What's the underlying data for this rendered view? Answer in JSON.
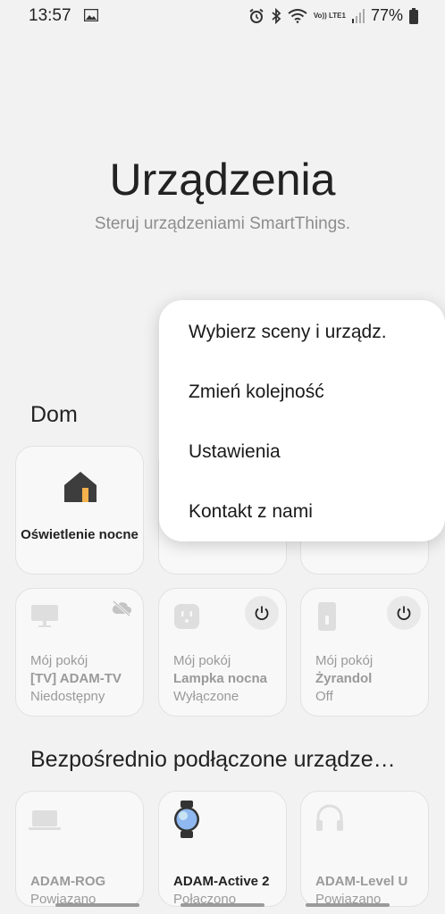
{
  "status_bar": {
    "time": "13:57",
    "battery": "77%",
    "volte": "Vo)) LTE1"
  },
  "header": {
    "title": "Urządzenia",
    "subtitle": "Steruj urządzeniami SmartThings."
  },
  "sections": {
    "home": "Dom",
    "direct": "Bezpośrednio podłączone urządze…"
  },
  "home_cards": {
    "night_light": {
      "label": "Oświetlenie nocne"
    },
    "tv": {
      "room": "Mój pokój",
      "name": "[TV] ADAM-TV",
      "status": "Niedostępny"
    },
    "lamp": {
      "room": "Mój pokój",
      "name": "Lampka nocna",
      "status": "Wyłączone"
    },
    "chandelier": {
      "room": "Mój pokój",
      "name": "Żyrandol",
      "status": "Off"
    }
  },
  "direct_cards": {
    "rog": {
      "name": "ADAM-ROG",
      "status": "Powiązano"
    },
    "watch": {
      "name": "ADAM-Active 2",
      "status": "Połączono"
    },
    "headphones": {
      "name": "ADAM-Level U",
      "status": "Powiązano"
    }
  },
  "menu": {
    "items": [
      "Wybierz sceny i urządz.",
      "Zmień kolejność",
      "Ustawienia",
      "Kontakt z nami"
    ]
  },
  "colors": {
    "background": "#f2f2f2",
    "card": "#f8f8f8",
    "house_roof": "#3d3d3d",
    "house_window": "#f5b14c",
    "watch_face": "#8fb8f0"
  }
}
